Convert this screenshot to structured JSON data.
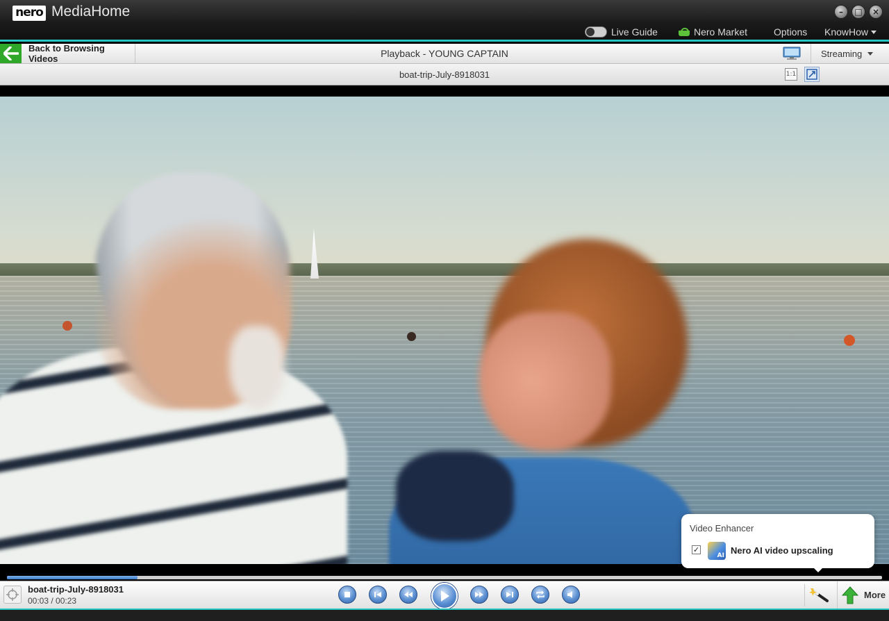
{
  "window": {
    "logo_text": "nero",
    "app_title": "MediaHome"
  },
  "topnav": {
    "live_guide": "Live Guide",
    "nero_market": "Nero Market",
    "options": "Options",
    "knowhow": "KnowHow"
  },
  "toolbar": {
    "back_label": "Back to Browsing Videos",
    "playback_title": "Playback - YOUNG CAPTAIN",
    "streaming_label": "Streaming"
  },
  "subbar": {
    "filename": "boat-trip-July-8918031",
    "ratio_label": "1:1"
  },
  "enhancer": {
    "title": "Video Enhancer",
    "option_label": "Nero AI video upscaling",
    "option_checked": true,
    "icon_text": "AI"
  },
  "controls": {
    "filename": "boat-trip-July-8918031",
    "time": "00:03 / 00:23",
    "progress_fraction": 0.149,
    "more_label": "More"
  },
  "colors": {
    "accent_teal": "#27c6c2",
    "back_green": "#2fa82a",
    "control_blue": "#3d7cc9"
  }
}
